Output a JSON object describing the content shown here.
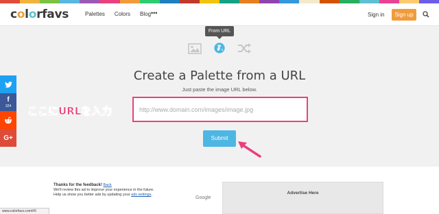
{
  "brand": {
    "logo_text": "colorfavs",
    "stripe_colors": [
      "#e14b3b",
      "#f0b33c",
      "#7bc144",
      "#5ab7e1",
      "#9b59b6",
      "#e8417e",
      "#f29b3a",
      "#2ecc71",
      "#1f7fbf",
      "#c0392b",
      "#f1c40f",
      "#16a085",
      "#e67e22",
      "#8e44ad",
      "#3498db",
      "#f4e9c9",
      "#d35400",
      "#27ae60",
      "#5fbfd3",
      "#e84393",
      "#fdcb6e",
      "#6c5ce7"
    ]
  },
  "nav": {
    "items": [
      "Palettes",
      "Colors",
      "Blog"
    ],
    "more": "•••",
    "signin": "Sign in",
    "signup": "Sign up"
  },
  "mode": {
    "tooltip": "From URL",
    "icons": [
      "image-icon",
      "globe-icon",
      "shuffle-icon"
    ]
  },
  "main": {
    "title": "Create a Palette from a URL",
    "subtitle": "Just paste the image URL below.",
    "url_placeholder": "http://www.domain.com/images/image.jpg",
    "url_value": "",
    "submit": "Submit",
    "annotation": "ここにURLを入力"
  },
  "social": {
    "twitter": "",
    "facebook_count": "324",
    "reddit": "",
    "gplus": "G+"
  },
  "ad": {
    "thanks_title": "Thanks for the feedback!",
    "back": "Back",
    "line1": "We'll review this ad to improve your experience in the future.",
    "line2_prefix": "Help us show you better ads by updating your",
    "settings_link": "ads settings",
    "line2_suffix": ".",
    "google": "Google",
    "advertise": "Advertise Here"
  },
  "statusbar": {
    "url": "www.colorfavs.com/#0"
  },
  "colors": {
    "accent_pink": "#e8417e",
    "submit_blue": "#4eb6e2",
    "signup_orange": "#f29b3a"
  }
}
